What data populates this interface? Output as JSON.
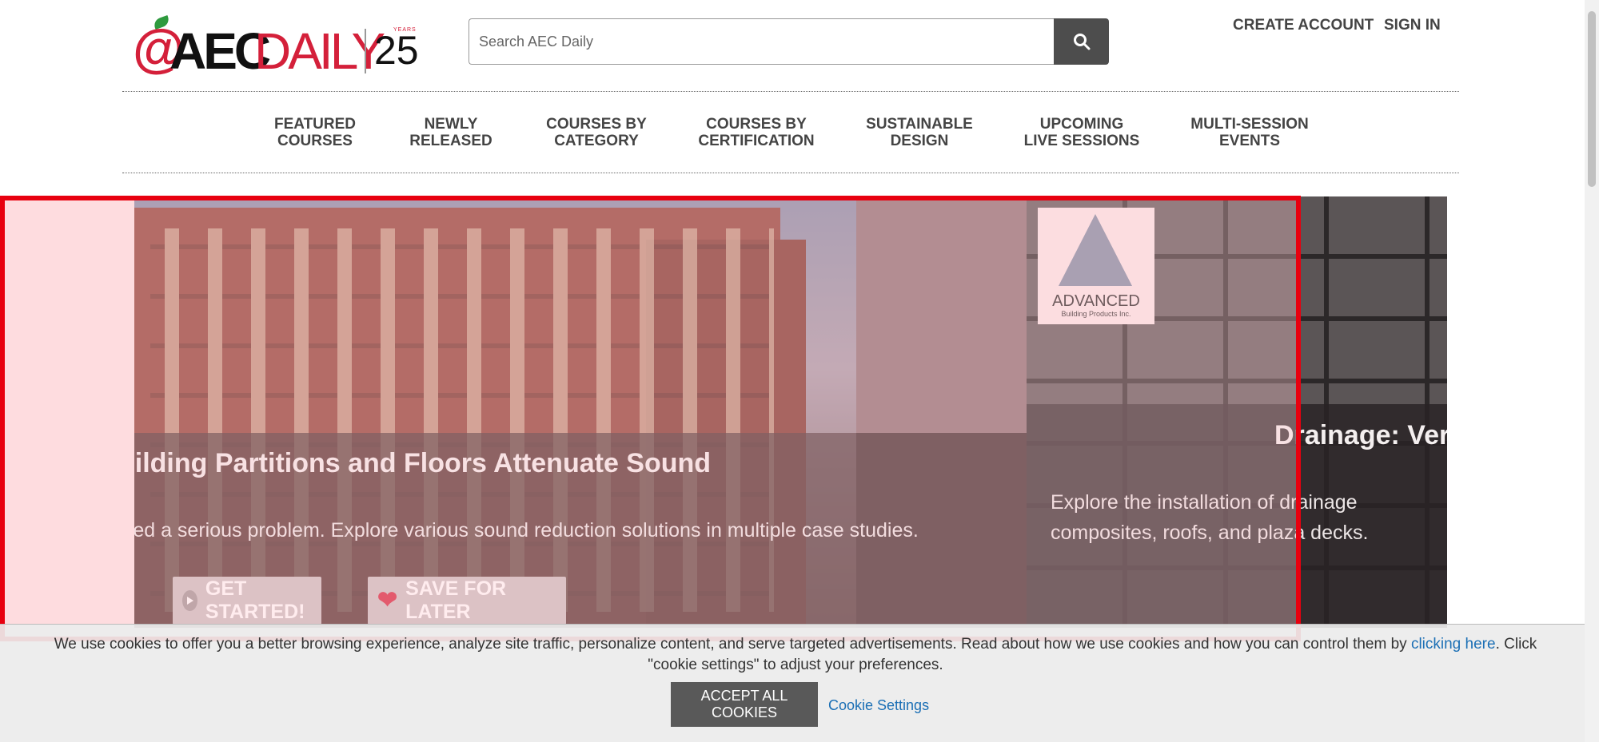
{
  "header": {
    "logo": {
      "at": "@",
      "aec": "AEC",
      "daily": "DAILY",
      "anniversary": "25",
      "years": "YEARS"
    },
    "search": {
      "placeholder": "Search AEC Daily"
    },
    "links": {
      "create_account": "CREATE ACCOUNT",
      "sign_in": "SIGN IN"
    }
  },
  "nav": {
    "items": [
      {
        "label": "FEATURED\nCOURSES"
      },
      {
        "label": "NEWLY\nRELEASED"
      },
      {
        "label": "COURSES BY\nCATEGORY"
      },
      {
        "label": "COURSES BY\nCERTIFICATION"
      },
      {
        "label": "SUSTAINABLE\nDESIGN"
      },
      {
        "label": "UPCOMING\nLIVE SESSIONS"
      },
      {
        "label": "MULTI-SESSION\nEVENTS"
      }
    ]
  },
  "hero": {
    "slide1": {
      "title": "uilding Partitions and Floors Attenuate Sound",
      "description": "red a serious problem. Explore various sound reduction solutions in multiple case studies.",
      "buttons": {
        "start": "GET STARTED!",
        "save": "SAVE FOR LATER"
      }
    },
    "slide2": {
      "vendor": {
        "name": "ADVANCED",
        "subtitle": "Building Products Inc."
      },
      "title": "Drainage: Verti",
      "description": "Explore the installation of drainage composites, roofs, and plaza decks."
    }
  },
  "cookie_banner": {
    "text_before": "We use cookies to offer you a better browsing experience, analyze site traffic, personalize content, and serve targeted advertisements. Read about how we use cookies and how you can control them by ",
    "link_text": "clicking here",
    "text_after": ". Click \"cookie settings\" to adjust your preferences.",
    "accept_label": "ACCEPT ALL COOKIES",
    "settings_label": "Cookie Settings"
  },
  "colors": {
    "brand_red": "#d4203a",
    "highlight_frame": "#e8000f",
    "link_blue": "#1b6fb5"
  }
}
